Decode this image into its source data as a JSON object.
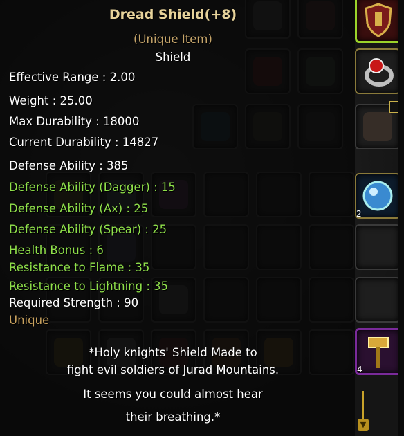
{
  "item": {
    "name": "Dread Shield(+8)",
    "rarity_label": "(Unique Item)",
    "item_type": "Shield",
    "stats": [
      {
        "text": "Effective Range : 2.00",
        "color": "white"
      },
      {
        "text": "Weight : 25.00",
        "color": "white"
      },
      {
        "text": "Max Durability : 18000",
        "color": "white"
      },
      {
        "text": "Current Durability : 14827",
        "color": "white"
      },
      {
        "text": "Defense Ability : 385",
        "color": "white"
      },
      {
        "text": "Defense Ability (Dagger) : 15",
        "color": "green"
      },
      {
        "text": "Defense Ability (Ax) : 25",
        "color": "green"
      },
      {
        "text": "Defense Ability (Spear) : 25",
        "color": "green"
      },
      {
        "text": "Health Bonus : 6",
        "color": "green"
      },
      {
        "text": "Resistance to Flame : 35",
        "color": "green"
      },
      {
        "text": "Resistance to Lightning : 35",
        "color": "green"
      },
      {
        "text": "Required Strength : 90",
        "color": "white"
      },
      {
        "text": "Unique",
        "color": "gold"
      }
    ],
    "lore": [
      "*Holy knights' Shield Made to",
      "fight evil soldiers of Jurad Mountains.",
      "It seems you could almost hear",
      "their breathing.*"
    ]
  },
  "inventory": {
    "stack_counts": {
      "sapphire": "2",
      "hammer": "4"
    }
  },
  "colors": {
    "title": "#e6d29a",
    "stat_white": "#ffffff",
    "stat_green": "#8fe04a",
    "unique_gold": "#c9a25e",
    "tooltip_bg": "rgba(6,6,6,0.78)",
    "selected_slot_frame": "#9bd32a"
  },
  "icons": {
    "equipped_shield": "crimson-shield-icon",
    "ring": "red-gem-ring-icon",
    "sapphire": "blue-orb-gem-icon",
    "hammer": "golden-warhammer-icon",
    "scroll_down": "chevron-down-icon"
  }
}
